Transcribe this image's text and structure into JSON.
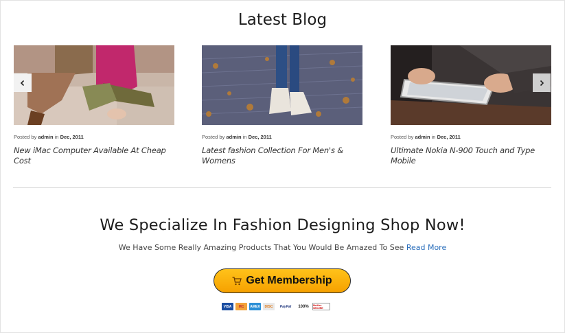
{
  "section": {
    "title": "Latest Blog"
  },
  "posts": [
    {
      "meta_prefix": "Posted by",
      "author": "admin",
      "meta_in": "in",
      "date": "Dec, 2011",
      "title": "New iMac Computer Available At Cheap Cost"
    },
    {
      "meta_prefix": "Posted by",
      "author": "admin",
      "meta_in": "in",
      "date": "Dec, 2011",
      "title": "Latest fashion Collection For Men's & Womens"
    },
    {
      "meta_prefix": "Posted by",
      "author": "admin",
      "meta_in": "in",
      "date": "Dec, 2011",
      "title": "Ultimate Nokia N-900 Touch and Type Mobile"
    }
  ],
  "carousel": {
    "prev_icon": "chevron-left-icon",
    "next_icon": "chevron-right-icon"
  },
  "promo": {
    "headline": "We Specialize In Fashion Designing Shop Now!",
    "text": "We Have Some Really Amazing Products That You Would Be Amazed To See",
    "link": "Read More",
    "button_label": "Get Membership",
    "button_icon": "cart-icon"
  },
  "payment_badges": [
    "VISA",
    "MC",
    "AMEX",
    "DISC",
    "PayPal",
    "100%",
    "McAfee SECURE"
  ],
  "colors": {
    "accent_button": "#f6a100",
    "link": "#2a6ebb"
  }
}
